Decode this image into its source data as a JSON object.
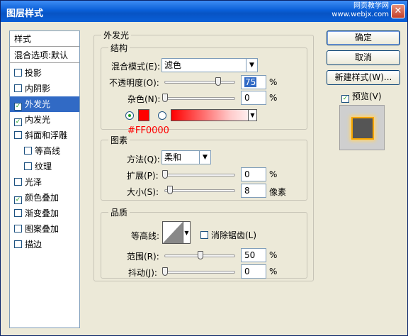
{
  "window": {
    "title": "图层样式",
    "watermark_line1": "网页教学网",
    "watermark_line2": "www.webjx.com",
    "close_glyph": "✕"
  },
  "sidebar": {
    "header": "样式",
    "blend_options": "混合选项:默认",
    "items": [
      {
        "label": "投影",
        "checked": false,
        "selected": false
      },
      {
        "label": "内阴影",
        "checked": false,
        "selected": false
      },
      {
        "label": "外发光",
        "checked": true,
        "selected": true
      },
      {
        "label": "内发光",
        "checked": true,
        "selected": false
      },
      {
        "label": "斜面和浮雕",
        "checked": false,
        "selected": false
      },
      {
        "label": "等高线",
        "checked": false,
        "selected": false,
        "indent": true
      },
      {
        "label": "纹理",
        "checked": false,
        "selected": false,
        "indent": true
      },
      {
        "label": "光泽",
        "checked": false,
        "selected": false
      },
      {
        "label": "颜色叠加",
        "checked": true,
        "selected": false
      },
      {
        "label": "渐变叠加",
        "checked": false,
        "selected": false
      },
      {
        "label": "图案叠加",
        "checked": false,
        "selected": false
      },
      {
        "label": "描边",
        "checked": false,
        "selected": false
      }
    ]
  },
  "outer_glow": {
    "title": "外发光",
    "structure": {
      "title": "结构",
      "blend_mode_label": "混合模式(E):",
      "blend_mode_value": "滤色",
      "opacity_label": "不透明度(O):",
      "opacity_value": "75",
      "opacity_level": 75,
      "noise_label": "杂色(N):",
      "noise_value": "0",
      "noise_level": 0,
      "percent": "%",
      "color_hex": "#FF0000"
    },
    "elements": {
      "title": "图素",
      "technique_label": "方法(Q):",
      "technique_value": "柔和",
      "spread_label": "扩展(P):",
      "spread_value": "0",
      "spread_level": 0,
      "size_label": "大小(S):",
      "size_value": "8",
      "size_unit": "像素",
      "percent": "%"
    },
    "quality": {
      "title": "品质",
      "contour_label": "等高线:",
      "antialias_label": "消除锯齿(L)",
      "range_label": "范围(R):",
      "range_value": "50",
      "range_level": 50,
      "jitter_label": "抖动(J):",
      "jitter_value": "0",
      "jitter_level": 0,
      "percent": "%"
    }
  },
  "buttons": {
    "ok": "确定",
    "cancel": "取消",
    "new_style": "新建样式(W)...",
    "preview": "预览(V)"
  },
  "colors": {
    "glow": "#ff0000",
    "selection": "#316ac5"
  }
}
